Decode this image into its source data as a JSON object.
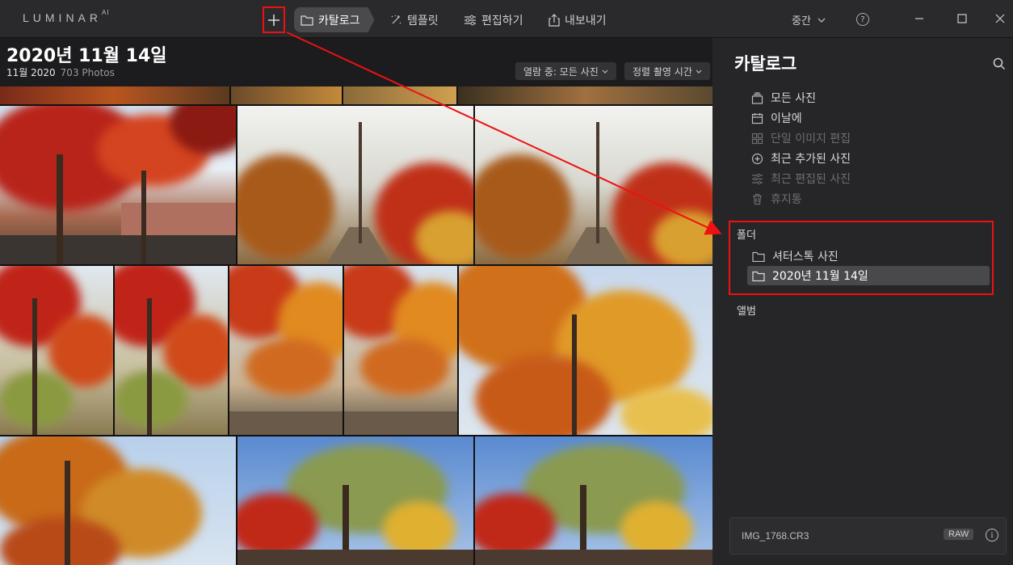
{
  "app": {
    "logo": "LUMINAR",
    "logo_sup": "AI"
  },
  "topbar": {
    "add_icon": "plus-icon",
    "nav": [
      {
        "label": "카탈로그",
        "icon": "folder-icon",
        "active": true
      },
      {
        "label": "템플릿",
        "icon": "sparkle-icon",
        "active": false
      },
      {
        "label": "편집하기",
        "icon": "sliders-icon",
        "active": false
      },
      {
        "label": "내보내기",
        "icon": "export-icon",
        "active": false
      }
    ],
    "zoom_label": "중간",
    "help_label": "?"
  },
  "gallery": {
    "title": "2020년 11월 14일",
    "month": "11월 2020",
    "count": "703 Photos",
    "filter_label": "열람 중: 모든 사진",
    "sort_label": "정렬 촬영 시간"
  },
  "sidebar": {
    "title": "카탈로그",
    "items": [
      {
        "label": "모든 사진",
        "icon": "stack-icon",
        "enabled": true
      },
      {
        "label": "이날에",
        "icon": "calendar-icon",
        "enabled": true
      },
      {
        "label": "단일 이미지 편집",
        "icon": "grid-icon",
        "enabled": false
      },
      {
        "label": "최근 추가된 사진",
        "icon": "plus-circle-icon",
        "enabled": true
      },
      {
        "label": "최근 편집된 사진",
        "icon": "sliders-icon",
        "enabled": false
      },
      {
        "label": "휴지통",
        "icon": "trash-icon",
        "enabled": false
      }
    ],
    "folders_label": "폴더",
    "folders": [
      {
        "label": "셔터스톡 사진",
        "selected": false
      },
      {
        "label": "2020년 11월 14일",
        "selected": true
      }
    ],
    "albums_label": "앨범"
  },
  "info": {
    "filename": "IMG_1768.CR3",
    "badge": "RAW",
    "info_label": "i"
  },
  "colors": {
    "highlight": "#ee1111",
    "accent": "#4a4a4d"
  }
}
